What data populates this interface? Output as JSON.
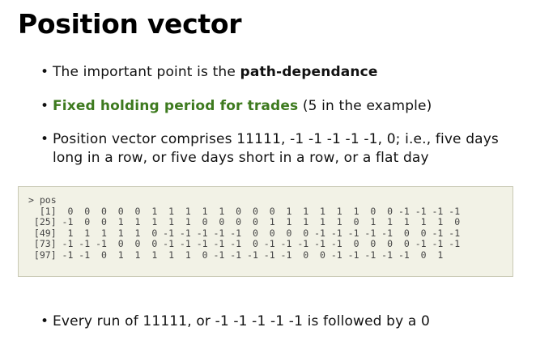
{
  "slide": {
    "title": "Position vector"
  },
  "bullets": [
    {
      "prefix": "The important point is the ",
      "emphasis": "path-dependance"
    },
    {
      "highlight": "Fixed holding period for trades",
      "suffix": " (5 in the example)"
    },
    {
      "text": "Position vector comprises 11111, -1 -1 -1 -1 -1, 0; i.e., five days long in a row, or five days short in a row, or a flat day"
    },
    {
      "text": "Every run of 11111, or -1 -1 -1 -1 -1 is followed by a 0"
    }
  ],
  "console": {
    "lines": [
      "> pos",
      "  [1]  0  0  0  0  0  1  1  1  1  1  0  0  0  1  1  1  1  1  0  0 -1 -1 -1 -1",
      " [25] -1  0  0  1  1  1  1  1  0  0  0  0  1  1  1  1  1  0  1  1  1  1  1  0",
      " [49]  1  1  1  1  1  0 -1 -1 -1 -1 -1  0  0  0  0 -1 -1 -1 -1 -1  0  0 -1 -1",
      " [73] -1 -1 -1  0  0  0 -1 -1 -1 -1 -1  0 -1 -1 -1 -1 -1  0  0  0  0 -1 -1 -1",
      " [97] -1 -1  0  1  1  1  1  1  0 -1 -1 -1 -1 -1  0  0 -1 -1 -1 -1 -1  0  1"
    ]
  },
  "colors": {
    "highlight_green": "#3d7a1e",
    "code_background": "#f2f2e6"
  }
}
